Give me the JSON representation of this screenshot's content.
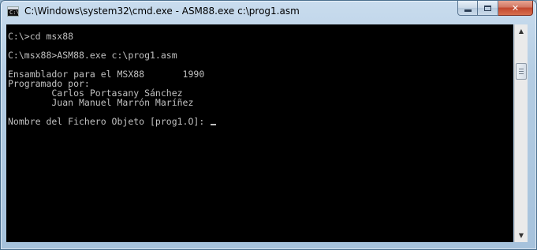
{
  "window": {
    "title": "C:\\Windows\\system32\\cmd.exe - ASM88.exe  c:\\prog1.asm",
    "icon_label": "C:\\",
    "buttons": {
      "minimize": "minimize",
      "maximize": "maximize",
      "close": "✕"
    }
  },
  "console": {
    "lines": [
      "C:\\>cd msx88",
      "",
      "C:\\msx88>ASM88.exe c:\\prog1.asm",
      "",
      "Ensamblador para el MSX88       1990",
      "Programado por:",
      "        Carlos Portasany Sánchez",
      "        Juan Manuel Marrón Maríñez",
      "",
      "Nombre del Fichero Objeto [prog1.O]: "
    ],
    "background": "#000000",
    "foreground": "#C0C0C0"
  },
  "scrollbar": {
    "up_arrow": "▲",
    "down_arrow": "▼"
  }
}
